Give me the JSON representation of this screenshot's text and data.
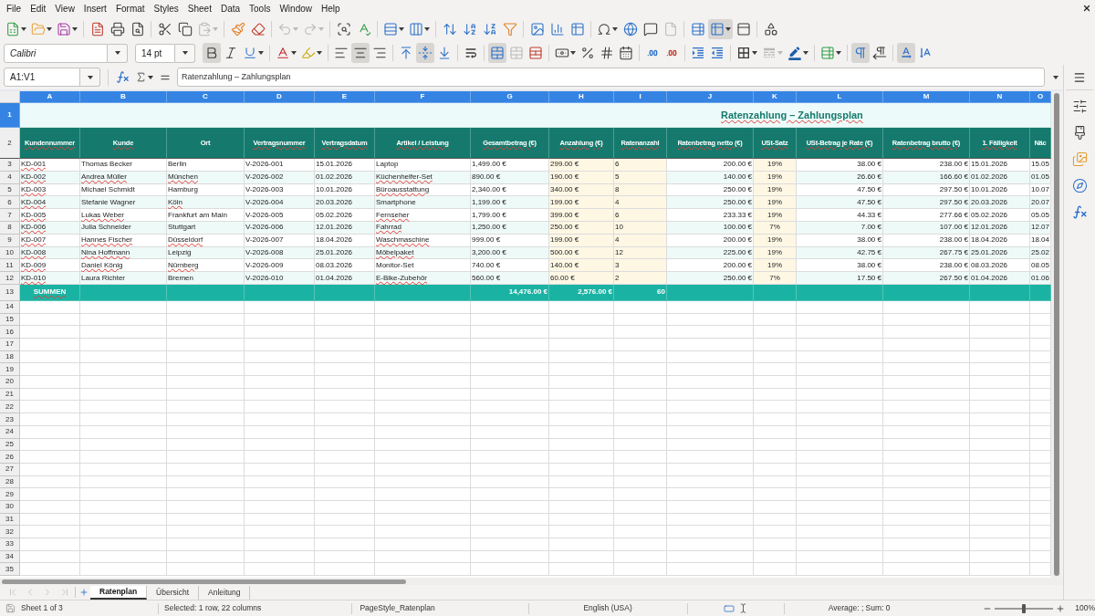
{
  "menu_bar": [
    "File",
    "Edit",
    "View",
    "Insert",
    "Format",
    "Styles",
    "Sheet",
    "Data",
    "Tools",
    "Window",
    "Help"
  ],
  "standard_toolbar": [
    {
      "active": false,
      "disabled": false
    },
    {
      "active": false,
      "disabled": false
    },
    {
      "active": false,
      "disabled": false
    },
    {
      "active": false,
      "disabled": false
    },
    {
      "active": false,
      "disabled": false
    },
    {
      "active": false,
      "disabled": false
    },
    {
      "active": false,
      "disabled": false
    },
    {
      "active": false,
      "disabled": false
    },
    {
      "active": false,
      "disabled": true
    },
    {
      "active": false,
      "disabled": false
    },
    {
      "active": false,
      "disabled": false
    },
    {
      "active": false,
      "disabled": true
    },
    {
      "active": false,
      "disabled": true
    },
    {
      "active": false,
      "disabled": false
    },
    {
      "active": false,
      "disabled": false
    },
    {
      "active": false,
      "disabled": false
    },
    {
      "active": false,
      "disabled": false
    },
    {
      "active": false,
      "disabled": false
    },
    {
      "active": false,
      "disabled": false
    },
    {
      "active": false,
      "disabled": false
    },
    {
      "active": false,
      "disabled": false
    },
    {
      "active": false,
      "disabled": false
    },
    {
      "active": false,
      "disabled": false
    },
    {
      "active": false,
      "disabled": false
    },
    {
      "active": false,
      "disabled": false
    },
    {
      "active": false,
      "disabled": false
    },
    {
      "active": false,
      "disabled": false
    },
    {
      "active": false,
      "disabled": true
    },
    {
      "active": false,
      "disabled": false
    },
    {
      "active": true,
      "disabled": false
    },
    {
      "active": false,
      "disabled": false
    },
    {
      "active": false,
      "disabled": false
    }
  ],
  "formatting_toolbar": {
    "font_name": "Calibri",
    "font_size": "14 pt",
    "buttons": [
      {
        "active": true,
        "disabled": false
      },
      {
        "active": false,
        "disabled": false
      },
      {
        "active": false,
        "disabled": false
      },
      {
        "active": false,
        "disabled": false
      },
      {
        "active": false,
        "disabled": false
      },
      {
        "active": false,
        "disabled": false
      },
      {
        "active": true,
        "disabled": false
      },
      {
        "active": false,
        "disabled": false
      },
      {
        "active": false,
        "disabled": false
      },
      {
        "active": true,
        "disabled": false
      },
      {
        "active": false,
        "disabled": false
      },
      {
        "active": false,
        "disabled": false
      },
      {
        "active": true,
        "disabled": false
      },
      {
        "active": false,
        "disabled": true
      },
      {
        "active": false,
        "disabled": false
      },
      {
        "active": false,
        "disabled": false
      },
      {
        "active": false,
        "disabled": false
      },
      {
        "active": false,
        "disabled": false
      },
      {
        "active": false,
        "disabled": false
      },
      {
        "active": false,
        "disabled": false
      },
      {
        "active": false,
        "disabled": false
      },
      {
        "active": false,
        "disabled": false
      },
      {
        "active": false,
        "disabled": false
      },
      {
        "active": false,
        "disabled": false
      },
      {
        "active": false,
        "disabled": true
      },
      {
        "active": false,
        "disabled": false
      },
      {
        "active": false,
        "disabled": false
      },
      {
        "active": true,
        "disabled": false
      },
      {
        "active": false,
        "disabled": false
      },
      {
        "active": true,
        "disabled": false
      },
      {
        "active": false,
        "disabled": false
      }
    ]
  },
  "formula_bar": {
    "name_box": "A1:V1",
    "formula": "Ratenzahlung – Zahlungsplan"
  },
  "sheet": {
    "columns": [
      {
        "letter": "A",
        "selected": true,
        "highlighted": false
      },
      {
        "letter": "B",
        "selected": true,
        "highlighted": false
      },
      {
        "letter": "C",
        "selected": true,
        "highlighted": false
      },
      {
        "letter": "D",
        "selected": true,
        "highlighted": false
      },
      {
        "letter": "E",
        "selected": true,
        "highlighted": false
      },
      {
        "letter": "F",
        "selected": true,
        "highlighted": false
      },
      {
        "letter": "G",
        "selected": true,
        "highlighted": false
      },
      {
        "letter": "H",
        "selected": true,
        "highlighted": true
      },
      {
        "letter": "I",
        "selected": true,
        "highlighted": true
      },
      {
        "letter": "J",
        "selected": true,
        "highlighted": false
      },
      {
        "letter": "K",
        "selected": true,
        "highlighted": true
      },
      {
        "letter": "L",
        "selected": true,
        "highlighted": false
      },
      {
        "letter": "M",
        "selected": true,
        "highlighted": false
      },
      {
        "letter": "N",
        "selected": true,
        "highlighted": false
      },
      {
        "letter": "O",
        "selected": true,
        "highlighted": false
      }
    ],
    "row_headers": [
      {
        "label": "1",
        "selected": true
      },
      {
        "label": "2",
        "selected": false
      },
      {
        "label": "3",
        "selected": false
      },
      {
        "label": "4",
        "selected": false
      },
      {
        "label": "5",
        "selected": false
      },
      {
        "label": "6",
        "selected": false
      },
      {
        "label": "7",
        "selected": false
      },
      {
        "label": "8",
        "selected": false
      },
      {
        "label": "9",
        "selected": false
      },
      {
        "label": "10",
        "selected": false
      },
      {
        "label": "11",
        "selected": false
      },
      {
        "label": "12",
        "selected": false
      },
      {
        "label": "13",
        "selected": false
      },
      {
        "label": "14",
        "selected": false
      },
      {
        "label": "15",
        "selected": false
      },
      {
        "label": "16",
        "selected": false
      },
      {
        "label": "17",
        "selected": false
      },
      {
        "label": "18",
        "selected": false
      },
      {
        "label": "19",
        "selected": false
      },
      {
        "label": "20",
        "selected": false
      },
      {
        "label": "21",
        "selected": false
      },
      {
        "label": "22",
        "selected": false
      },
      {
        "label": "23",
        "selected": false
      },
      {
        "label": "24",
        "selected": false
      },
      {
        "label": "25",
        "selected": false
      },
      {
        "label": "26",
        "selected": false
      },
      {
        "label": "27",
        "selected": false
      },
      {
        "label": "28",
        "selected": false
      },
      {
        "label": "29",
        "selected": false
      },
      {
        "label": "30",
        "selected": false
      },
      {
        "label": "31",
        "selected": false
      },
      {
        "label": "32",
        "selected": false
      },
      {
        "label": "33",
        "selected": false
      },
      {
        "label": "34",
        "selected": false
      },
      {
        "label": "35",
        "selected": false
      }
    ],
    "title": {
      "text": "Ratenzahlung – Zahlungsplan",
      "misspelled": true
    },
    "headers": [
      {
        "text": "Kundennummer",
        "misspelled": true
      },
      {
        "text": "Kunde",
        "misspelled": true
      },
      {
        "text": "Ort",
        "misspelled": false
      },
      {
        "text": "Vertragsnummer",
        "misspelled": true
      },
      {
        "text": "Vertragsdatum",
        "misspelled": true
      },
      {
        "text": "Artikel / Leistung",
        "misspelled": true
      },
      {
        "text": "Gesamtbetrag (€)",
        "misspelled": true
      },
      {
        "text": "Anzahlung (€)",
        "misspelled": true
      },
      {
        "text": "Ratenanzahl",
        "misspelled": true
      },
      {
        "text": "Ratenbetrag netto (€)",
        "misspelled": true
      },
      {
        "text": "USt-Satz",
        "misspelled": true
      },
      {
        "text": "USt-Betrag je Rate (€)",
        "misspelled": true
      },
      {
        "text": "Ratenbetrag brutto (€)",
        "misspelled": true
      },
      {
        "text": "1. Fälligkeit",
        "misspelled": true
      },
      {
        "text": "Näc",
        "misspelled": false
      }
    ],
    "rows": [
      {
        "cells": [
          {
            "text": "KD-001",
            "misspelled": true
          },
          {
            "text": "Thomas Becker",
            "misspelled": false
          },
          {
            "text": "Berlin",
            "misspelled": false
          },
          {
            "text": "V-2026-001",
            "misspelled": false
          },
          {
            "text": "15.01.2026",
            "misspelled": false
          },
          {
            "text": "Laptop",
            "misspelled": false
          },
          {
            "text": "1,499.00 €",
            "misspelled": false
          },
          {
            "text": "299.00 €",
            "misspelled": false
          },
          {
            "text": "6",
            "misspelled": false
          },
          {
            "text": "200.00 €",
            "misspelled": false
          },
          {
            "text": "19%",
            "misspelled": false
          },
          {
            "text": "38.00 €",
            "misspelled": false
          },
          {
            "text": "238.00 €",
            "misspelled": false
          },
          {
            "text": "15.01.2026",
            "misspelled": false
          },
          {
            "text": "15.05",
            "misspelled": false
          }
        ]
      },
      {
        "cells": [
          {
            "text": "KD-002",
            "misspelled": true
          },
          {
            "text": "Andrea Müller",
            "misspelled": true
          },
          {
            "text": "München",
            "misspelled": true
          },
          {
            "text": "V-2026-002",
            "misspelled": false
          },
          {
            "text": "01.02.2026",
            "misspelled": false
          },
          {
            "text": "Küchenhelfer-Set",
            "misspelled": true
          },
          {
            "text": "890.00 €",
            "misspelled": false
          },
          {
            "text": "190.00 €",
            "misspelled": false
          },
          {
            "text": "5",
            "misspelled": false
          },
          {
            "text": "140.00 €",
            "misspelled": false
          },
          {
            "text": "19%",
            "misspelled": false
          },
          {
            "text": "26.60 €",
            "misspelled": false
          },
          {
            "text": "166.60 €",
            "misspelled": false
          },
          {
            "text": "01.02.2026",
            "misspelled": false
          },
          {
            "text": "01.05",
            "misspelled": false
          }
        ]
      },
      {
        "cells": [
          {
            "text": "KD-003",
            "misspelled": true
          },
          {
            "text": "Michael Schmidt",
            "misspelled": false
          },
          {
            "text": "Hamburg",
            "misspelled": false
          },
          {
            "text": "V-2026-003",
            "misspelled": false
          },
          {
            "text": "10.01.2026",
            "misspelled": false
          },
          {
            "text": "Büroausstattung",
            "misspelled": true
          },
          {
            "text": "2,340.00 €",
            "misspelled": false
          },
          {
            "text": "340.00 €",
            "misspelled": false
          },
          {
            "text": "8",
            "misspelled": false
          },
          {
            "text": "250.00 €",
            "misspelled": false
          },
          {
            "text": "19%",
            "misspelled": false
          },
          {
            "text": "47.50 €",
            "misspelled": false
          },
          {
            "text": "297.50 €",
            "misspelled": false
          },
          {
            "text": "10.01.2026",
            "misspelled": false
          },
          {
            "text": "10.07",
            "misspelled": false
          }
        ]
      },
      {
        "cells": [
          {
            "text": "KD-004",
            "misspelled": true
          },
          {
            "text": "Stefanie Wagner",
            "misspelled": false
          },
          {
            "text": "Köln",
            "misspelled": true
          },
          {
            "text": "V-2026-004",
            "misspelled": false
          },
          {
            "text": "20.03.2026",
            "misspelled": false
          },
          {
            "text": "Smartphone",
            "misspelled": false
          },
          {
            "text": "1,199.00 €",
            "misspelled": false
          },
          {
            "text": "199.00 €",
            "misspelled": false
          },
          {
            "text": "4",
            "misspelled": false
          },
          {
            "text": "250.00 €",
            "misspelled": false
          },
          {
            "text": "19%",
            "misspelled": false
          },
          {
            "text": "47.50 €",
            "misspelled": false
          },
          {
            "text": "297.50 €",
            "misspelled": false
          },
          {
            "text": "20.03.2026",
            "misspelled": false
          },
          {
            "text": "20.07",
            "misspelled": false
          }
        ]
      },
      {
        "cells": [
          {
            "text": "KD-005",
            "misspelled": true
          },
          {
            "text": "Lukas Weber",
            "misspelled": true
          },
          {
            "text": "Frankfurt am Main",
            "misspelled": false
          },
          {
            "text": "V-2026-005",
            "misspelled": false
          },
          {
            "text": "05.02.2026",
            "misspelled": false
          },
          {
            "text": "Fernseher",
            "misspelled": true
          },
          {
            "text": "1,799.00 €",
            "misspelled": false
          },
          {
            "text": "399.00 €",
            "misspelled": false
          },
          {
            "text": "6",
            "misspelled": false
          },
          {
            "text": "233.33 €",
            "misspelled": false
          },
          {
            "text": "19%",
            "misspelled": false
          },
          {
            "text": "44.33 €",
            "misspelled": false
          },
          {
            "text": "277.66 €",
            "misspelled": false
          },
          {
            "text": "05.02.2026",
            "misspelled": false
          },
          {
            "text": "05.05",
            "misspelled": false
          }
        ]
      },
      {
        "cells": [
          {
            "text": "KD-006",
            "misspelled": true
          },
          {
            "text": "Julia Schneider",
            "misspelled": false
          },
          {
            "text": "Stuttgart",
            "misspelled": false
          },
          {
            "text": "V-2026-006",
            "misspelled": false
          },
          {
            "text": "12.01.2026",
            "misspelled": false
          },
          {
            "text": "Fahrrad",
            "misspelled": true
          },
          {
            "text": "1,250.00 €",
            "misspelled": false
          },
          {
            "text": "250.00 €",
            "misspelled": false
          },
          {
            "text": "10",
            "misspelled": false
          },
          {
            "text": "100.00 €",
            "misspelled": false
          },
          {
            "text": "7%",
            "misspelled": false
          },
          {
            "text": "7.00 €",
            "misspelled": false
          },
          {
            "text": "107.00 €",
            "misspelled": false
          },
          {
            "text": "12.01.2026",
            "misspelled": false
          },
          {
            "text": "12.07",
            "misspelled": false
          }
        ]
      },
      {
        "cells": [
          {
            "text": "KD-007",
            "misspelled": true
          },
          {
            "text": "Hannes Fischer",
            "misspelled": true
          },
          {
            "text": "Düsseldorf",
            "misspelled": true
          },
          {
            "text": "V-2026-007",
            "misspelled": false
          },
          {
            "text": "18.04.2026",
            "misspelled": false
          },
          {
            "text": "Waschmaschine",
            "misspelled": true
          },
          {
            "text": "999.00 €",
            "misspelled": false
          },
          {
            "text": "199.00 €",
            "misspelled": false
          },
          {
            "text": "4",
            "misspelled": false
          },
          {
            "text": "200.00 €",
            "misspelled": false
          },
          {
            "text": "19%",
            "misspelled": false
          },
          {
            "text": "38.00 €",
            "misspelled": false
          },
          {
            "text": "238.00 €",
            "misspelled": false
          },
          {
            "text": "18.04.2026",
            "misspelled": false
          },
          {
            "text": "18.04",
            "misspelled": false
          }
        ]
      },
      {
        "cells": [
          {
            "text": "KD-008",
            "misspelled": true
          },
          {
            "text": "Nina Hoffmann",
            "misspelled": true
          },
          {
            "text": "Leipzig",
            "misspelled": false
          },
          {
            "text": "V-2026-008",
            "misspelled": false
          },
          {
            "text": "25.01.2026",
            "misspelled": false
          },
          {
            "text": "Möbelpaket",
            "misspelled": true
          },
          {
            "text": "3,200.00 €",
            "misspelled": false
          },
          {
            "text": "500.00 €",
            "misspelled": false
          },
          {
            "text": "12",
            "misspelled": false
          },
          {
            "text": "225.00 €",
            "misspelled": false
          },
          {
            "text": "19%",
            "misspelled": false
          },
          {
            "text": "42.75 €",
            "misspelled": false
          },
          {
            "text": "267.75 €",
            "misspelled": false
          },
          {
            "text": "25.01.2026",
            "misspelled": false
          },
          {
            "text": "25.02",
            "misspelled": false
          }
        ]
      },
      {
        "cells": [
          {
            "text": "KD-009",
            "misspelled": true
          },
          {
            "text": "Daniel König",
            "misspelled": true
          },
          {
            "text": "Nürnberg",
            "misspelled": true
          },
          {
            "text": "V-2026-009",
            "misspelled": false
          },
          {
            "text": "08.03.2026",
            "misspelled": false
          },
          {
            "text": "Monitor-Set",
            "misspelled": false
          },
          {
            "text": "740.00 €",
            "misspelled": false
          },
          {
            "text": "140.00 €",
            "misspelled": false
          },
          {
            "text": "3",
            "misspelled": false
          },
          {
            "text": "200.00 €",
            "misspelled": false
          },
          {
            "text": "19%",
            "misspelled": false
          },
          {
            "text": "38.00 €",
            "misspelled": false
          },
          {
            "text": "238.00 €",
            "misspelled": false
          },
          {
            "text": "08.03.2026",
            "misspelled": false
          },
          {
            "text": "08.05",
            "misspelled": false
          }
        ]
      },
      {
        "cells": [
          {
            "text": "KD-010",
            "misspelled": true
          },
          {
            "text": "Laura Richter",
            "misspelled": false
          },
          {
            "text": "Bremen",
            "misspelled": false
          },
          {
            "text": "V-2026-010",
            "misspelled": false
          },
          {
            "text": "01.04.2026",
            "misspelled": false
          },
          {
            "text": "E-Bike-Zubehör",
            "misspelled": true
          },
          {
            "text": "560.00 €",
            "misspelled": false
          },
          {
            "text": "60.00 €",
            "misspelled": false
          },
          {
            "text": "2",
            "misspelled": false
          },
          {
            "text": "250.00 €",
            "misspelled": false
          },
          {
            "text": "7%",
            "misspelled": false
          },
          {
            "text": "17.50 €",
            "misspelled": false
          },
          {
            "text": "267.50 €",
            "misspelled": false
          },
          {
            "text": "01.04.2026",
            "misspelled": false
          },
          {
            "text": "01.06",
            "misspelled": false
          }
        ]
      }
    ],
    "totals": {
      "label": {
        "text": "SUMMEN",
        "misspelled": true
      },
      "gesamtbetrag": "14,476.00 €",
      "anzahlung": "2,576.00 €",
      "ratenanzahl": "60"
    }
  },
  "sheet_tabs": {
    "navigation_disabled": true,
    "tabs": [
      {
        "label": "Ratenplan",
        "selected": true
      },
      {
        "label": "Übersicht",
        "selected": false
      },
      {
        "label": "Anleitung",
        "selected": false
      }
    ]
  },
  "status_bar": {
    "sheet_position": "Sheet 1 of 3",
    "selection": "Selected: 1 row, 22 columns",
    "page_style": "PageStyle_Ratenplan",
    "language": "English (USA)",
    "summary": "Average: ; Sum: 0",
    "zoom": {
      "level": 0.5,
      "reading": "100%"
    }
  }
}
